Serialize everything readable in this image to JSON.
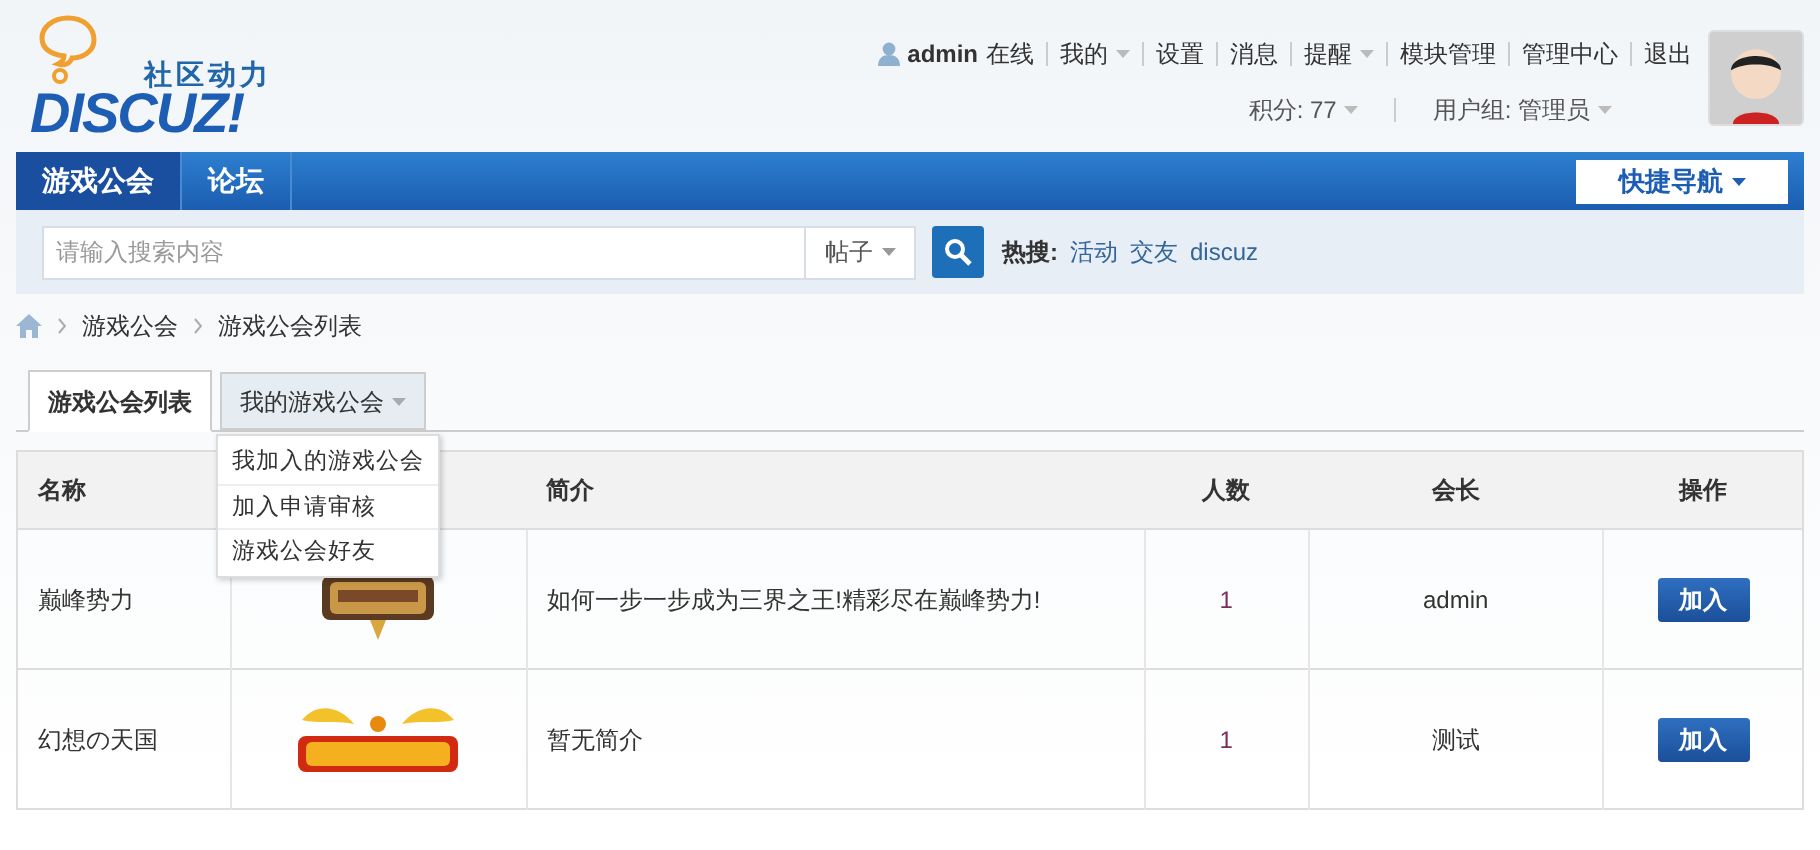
{
  "logo": {
    "brand": "DISCUZ!",
    "slogan": "社区动力"
  },
  "user_bar": {
    "username": "admin",
    "status": "在线",
    "links": [
      {
        "label": "我的",
        "dropdown": true
      },
      {
        "label": "设置",
        "dropdown": false
      },
      {
        "label": "消息",
        "dropdown": false
      },
      {
        "label": "提醒",
        "dropdown": true
      },
      {
        "label": "模块管理",
        "dropdown": false
      },
      {
        "label": "管理中心",
        "dropdown": false
      },
      {
        "label": "退出",
        "dropdown": false
      }
    ],
    "credits": "积分: 77",
    "group": "用户组: 管理员"
  },
  "nav": {
    "items": [
      {
        "label": "游戏公会",
        "selected": true
      },
      {
        "label": "论坛",
        "selected": false
      }
    ],
    "quick_nav": "快捷导航"
  },
  "search": {
    "placeholder": "请输入搜索内容",
    "type": "帖子",
    "hot_label": "热搜:",
    "hot": [
      "活动",
      "交友",
      "discuz"
    ]
  },
  "breadcrumb": [
    "游戏公会",
    "游戏公会列表"
  ],
  "tabs": [
    {
      "label": "游戏公会列表",
      "selected": true,
      "dropdown": false
    },
    {
      "label": "我的游戏公会",
      "selected": false,
      "dropdown": true
    }
  ],
  "dropdown_menu": [
    "我加入的游戏公会",
    "加入申请审核",
    "游戏公会好友"
  ],
  "table": {
    "columns": [
      "名称",
      "",
      "简介",
      "人数",
      "会长",
      "操作"
    ],
    "rows": [
      {
        "name": "巅峰势力",
        "intro": "如何一步一步成为三界之王!精彩尽在巅峰势力!",
        "members": "1",
        "leader": "admin",
        "action": "加入"
      },
      {
        "name": "幻想の天国",
        "intro": "暂无简介",
        "members": "1",
        "leader": "测试",
        "action": "加入"
      }
    ]
  }
}
